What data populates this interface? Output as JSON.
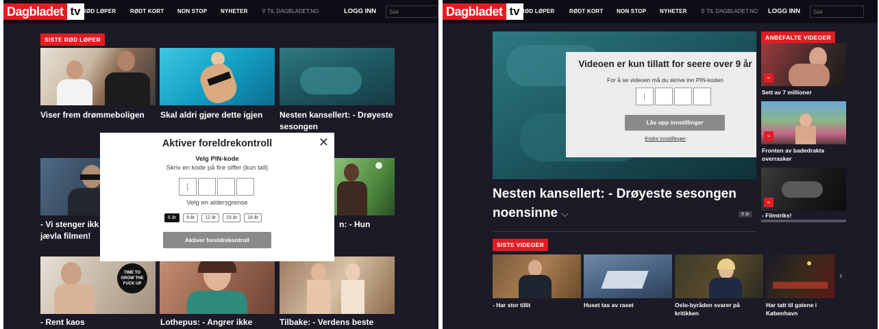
{
  "left": {
    "header": {
      "brand": "Dagbladet",
      "tv": "tv",
      "nav": [
        "RØD LØPER",
        "RØDT KORT",
        "NON STOP",
        "NYHETER"
      ],
      "external_link": "TIL DAGBLADET.NO",
      "login": "LOGG INN",
      "search_placeholder": "Søk"
    },
    "section_tag": "SISTE RØD LØPER",
    "cards": [
      {
        "caption": "Viser frem drømmeboligen"
      },
      {
        "caption": "Skal aldri gjøre dette igjen"
      },
      {
        "caption": "Nesten kansellert: - Drøyeste sesongen"
      },
      {
        "caption": "- Vi stenger ikk jævla filmen!"
      },
      {
        "caption": "n: - Hun"
      },
      {
        "caption": "- Rent kaos"
      },
      {
        "caption": "Lothepus: - Angrer ikke"
      },
      {
        "caption": "Tilbake: - Verdens beste"
      }
    ],
    "modal": {
      "title": "Aktiver foreldrekontroll",
      "pin_heading": "Velg PIN-kode",
      "pin_instructions": "Skriv en kode på fire siffer (kun tall)",
      "age_heading": "Velg en aldersgrense",
      "ages": [
        "6 år",
        "9 år",
        "12 år",
        "15 år",
        "18 år"
      ],
      "selected_age": "6 år",
      "button": "Aktiver foreldrekontroll",
      "close": "✕"
    }
  },
  "right": {
    "header": {
      "brand": "Dagbladet",
      "tv": "tv",
      "nav": [
        "RØD LØPER",
        "RØDT KORT",
        "NON STOP",
        "NYHETER"
      ],
      "external_link": "TIL DAGBLADET.NO",
      "login": "LOGG INN",
      "search_placeholder": "Søk"
    },
    "age_gate": {
      "title": "Videoen er kun tillatt for seere over 9 år",
      "instructions": "For å se videoen må du skrive inn PIN-koden",
      "button": "Lås opp innstillinger",
      "link": "Endre innstillinger"
    },
    "video_title": "Nesten kansellert: - Drøyeste sesongen noensinne",
    "chevron": "⌵",
    "age_badge": "9 år",
    "recommended_tag": "ANBEFALTE VIDEOER",
    "recommended": [
      {
        "caption": "Sett av 7 millioner"
      },
      {
        "caption": "Fronten av badedrakta overrasker"
      },
      {
        "caption": "- Filmtriks!"
      }
    ],
    "latest_tag": "SISTE VIDEOER",
    "latest": [
      {
        "caption": "- Har stor tillit"
      },
      {
        "caption": "Huset tas av raset"
      },
      {
        "caption": "Oslo-byråden svarer på kritikken"
      },
      {
        "caption": "Har tatt til gatene i København"
      }
    ],
    "next_arrow": "›"
  }
}
